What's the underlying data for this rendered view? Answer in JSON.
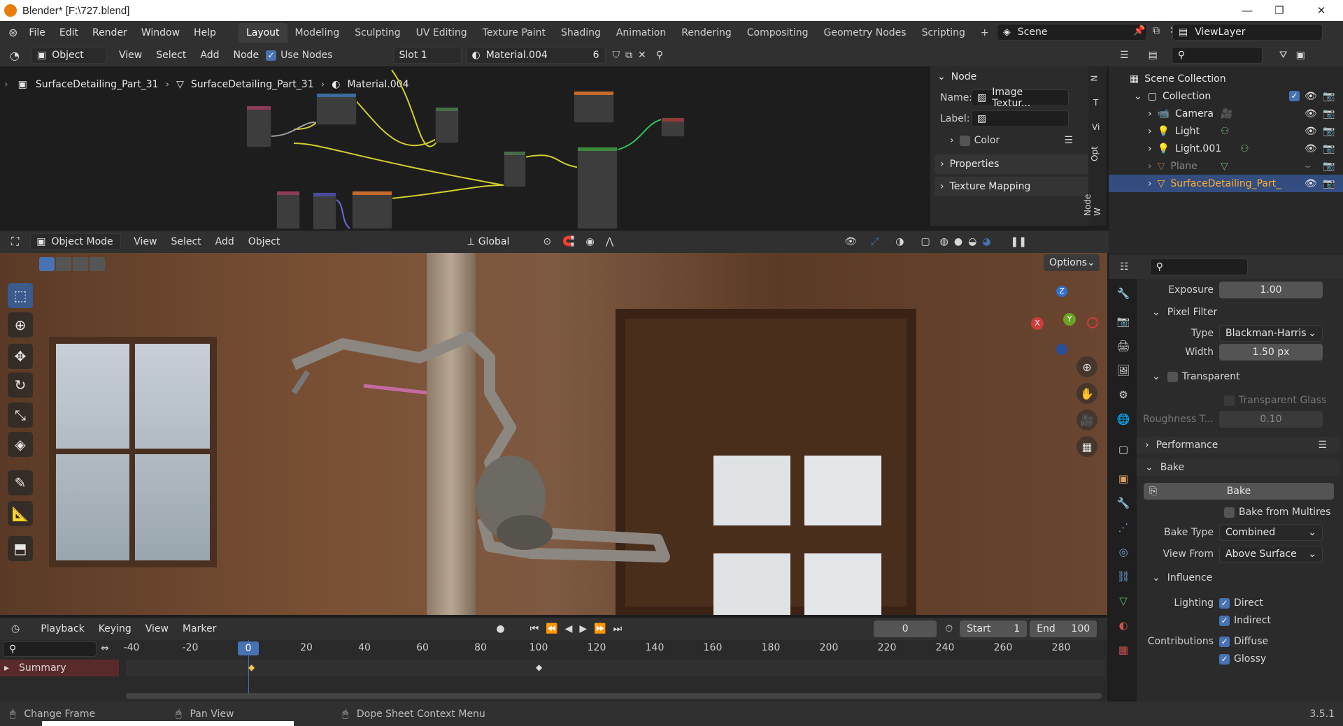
{
  "window": {
    "title": "Blender* [F:\\727.blend]"
  },
  "menus": [
    "File",
    "Edit",
    "Render",
    "Window",
    "Help"
  ],
  "workspaces": [
    "Layout",
    "Modeling",
    "Sculpting",
    "UV Editing",
    "Texture Paint",
    "Shading",
    "Animation",
    "Rendering",
    "Compositing",
    "Geometry Nodes",
    "Scripting"
  ],
  "active_workspace": "Layout",
  "scene": "Scene",
  "view_layer": "ViewLayer",
  "node_editor": {
    "object_mode": "Object",
    "menu": [
      "View",
      "Select",
      "Add",
      "Node"
    ],
    "use_nodes": "Use Nodes",
    "slot": "Slot 1",
    "material": "Material.004",
    "users": "6",
    "breadcrumb": [
      "SurfaceDetailing_Part_31",
      "SurfaceDetailing_Part_31",
      "Material.004"
    ],
    "panel_tabs": [
      "Node",
      "Tool",
      "View",
      "Options",
      "Node Wrangler"
    ],
    "panel_tabs_short": [
      "N",
      "T",
      "Vi",
      "Opt",
      "Node W"
    ],
    "node_panel": {
      "title": "Node",
      "name_label": "Name:",
      "name_value": "Image Textur...",
      "label_label": "Label:",
      "label_value": "",
      "color": "Color",
      "properties": "Properties",
      "texture_mapping": "Texture Mapping"
    }
  },
  "viewport": {
    "mode": "Object Mode",
    "menu": [
      "View",
      "Select",
      "Add",
      "Object"
    ],
    "orientation": "Global",
    "options": "Options",
    "gizmo": {
      "z": "Z",
      "y": "Y",
      "x": "X"
    }
  },
  "outliner": {
    "items": [
      {
        "label": "Scene Collection",
        "level": 0
      },
      {
        "label": "Collection",
        "level": 1
      },
      {
        "label": "Camera",
        "level": 2
      },
      {
        "label": "Light",
        "level": 2
      },
      {
        "label": "Light.001",
        "level": 2
      },
      {
        "label": "Plane",
        "level": 2
      },
      {
        "label": "SurfaceDetailing_Part_",
        "level": 2
      }
    ]
  },
  "properties": {
    "exposure_label": "Exposure",
    "exposure": "1.00",
    "pixel_filter": "Pixel Filter",
    "type_label": "Type",
    "type": "Blackman-Harris",
    "width_label": "Width",
    "width": "1.50 px",
    "transparent": "Transparent",
    "transparent_glass": "Transparent Glass",
    "roughness_label": "Roughness T...",
    "roughness": "0.10",
    "performance": "Performance",
    "bake_section": "Bake",
    "bake_button": "Bake",
    "bake_from_multires": "Bake from Multires",
    "bake_type_label": "Bake Type",
    "bake_type": "Combined",
    "view_from_label": "View From",
    "view_from": "Above Surface",
    "influence": "Influence",
    "lighting_label": "Lighting",
    "direct": "Direct",
    "indirect": "Indirect",
    "contributions_label": "Contributions",
    "diffuse": "Diffuse",
    "glossy": "Glossy"
  },
  "timeline": {
    "menu": [
      "Playback",
      "Keying",
      "View",
      "Marker"
    ],
    "current_frame": "0",
    "start_label": "Start",
    "start": "1",
    "end_label": "End",
    "end": "100",
    "ticks": [
      "-40",
      "-20",
      "0",
      "20",
      "40",
      "60",
      "80",
      "100",
      "120",
      "140",
      "160",
      "180",
      "200",
      "220",
      "240",
      "260",
      "280"
    ],
    "summary": "Summary"
  },
  "statusbar": {
    "change_frame": "Change Frame",
    "pan_view": "Pan View",
    "context_menu": "Dope Sheet Context Menu",
    "version": "3.5.1"
  },
  "colors": {
    "accent": "#4772b3",
    "selected_row": "#334d80",
    "header": "#303030",
    "playhead": "#4772b3",
    "summary": "#5a2a2a"
  }
}
